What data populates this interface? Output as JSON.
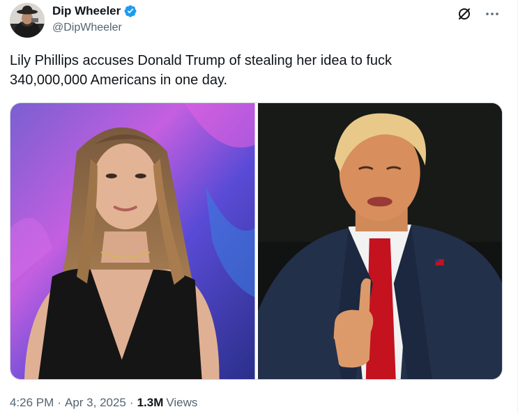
{
  "author": {
    "display_name": "Dip Wheeler",
    "handle": "@DipWheeler",
    "verified": true,
    "verified_color": "#1d9bf0"
  },
  "tweet": {
    "text": "Lily Phillips accuses Donald Trump of stealing her idea to fuck\n340,000,000 Americans in one day."
  },
  "actions": {
    "grok_icon": "grok-icon",
    "more_icon": "more-icon"
  },
  "media": [
    {
      "name": "photo-woman-portrait"
    },
    {
      "name": "photo-man-thumbs-up"
    }
  ],
  "meta": {
    "time": "4:26 PM",
    "separator": "·",
    "date": "Apr 3, 2025",
    "views_count": "1.3M",
    "views_label": "Views"
  },
  "colors": {
    "text_primary": "#0f1419",
    "text_secondary": "#536471",
    "border": "#cfd9de"
  }
}
